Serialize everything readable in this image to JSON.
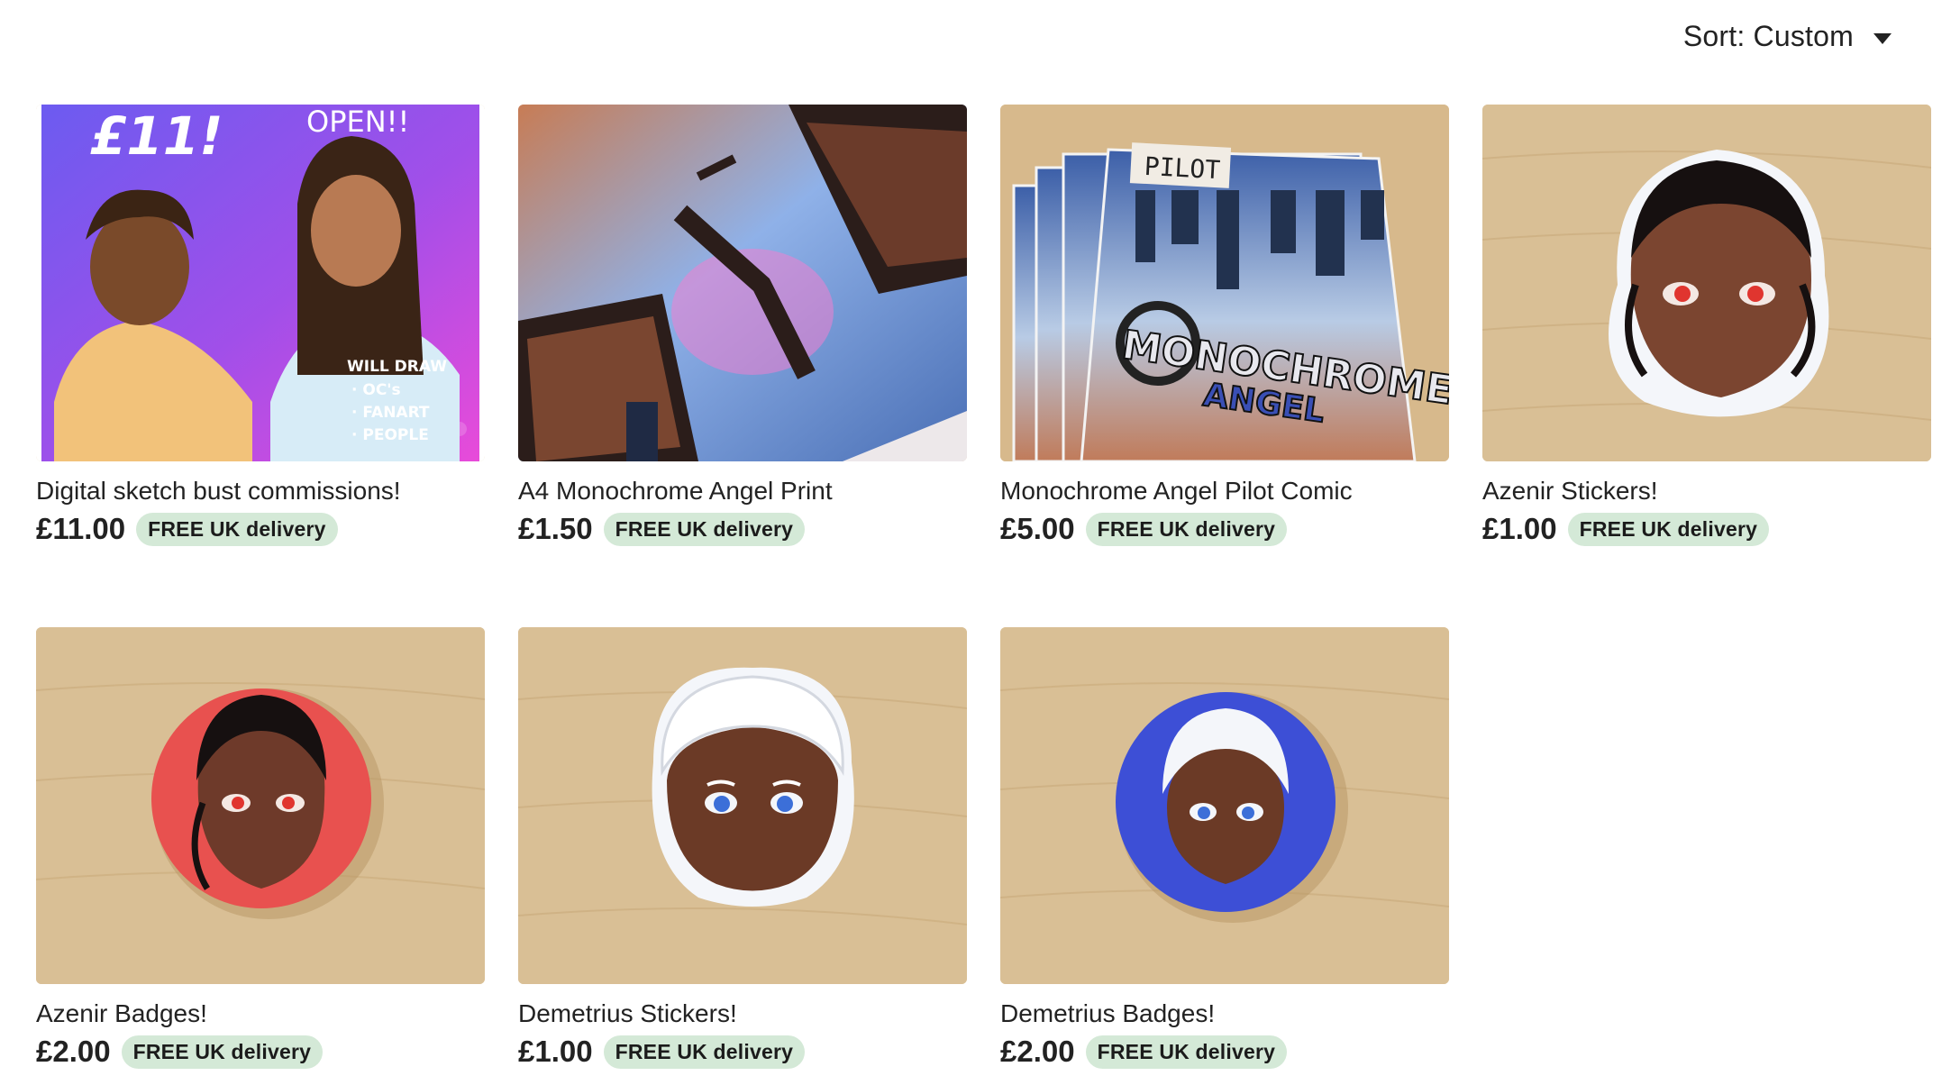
{
  "sort": {
    "label": "Sort: Custom"
  },
  "listings": [
    {
      "title": "Digital sketch bust commissions!",
      "price": "£11.00",
      "delivery": "FREE UK delivery",
      "image_text": {
        "price": "£11!",
        "open": "OPEN!!",
        "line1": "WILL DRAW",
        "line2": "· OC's",
        "line3": "· FANART",
        "line4": "· PEOPLE"
      }
    },
    {
      "title": "A4 Monochrome Angel Print",
      "price": "£1.50",
      "delivery": "FREE UK delivery"
    },
    {
      "title": "Monochrome Angel Pilot Comic",
      "price": "£5.00",
      "delivery": "FREE UK delivery",
      "image_text": {
        "tab": "PILOT",
        "logo1": "MONOCHROME",
        "logo2": "ANGEL"
      }
    },
    {
      "title": "Azenir Stickers!",
      "price": "£1.00",
      "delivery": "FREE UK delivery"
    },
    {
      "title": "Azenir Badges!",
      "price": "£2.00",
      "delivery": "FREE UK delivery"
    },
    {
      "title": "Demetrius Stickers!",
      "price": "£1.00",
      "delivery": "FREE UK delivery"
    },
    {
      "title": "Demetrius Badges!",
      "price": "£2.00",
      "delivery": "FREE UK delivery"
    }
  ],
  "colors": {
    "badge_bg": "#d4e9d7",
    "wood": "#d9bf95",
    "badge_red": "#e8514f",
    "badge_blue": "#3d4fd6"
  }
}
